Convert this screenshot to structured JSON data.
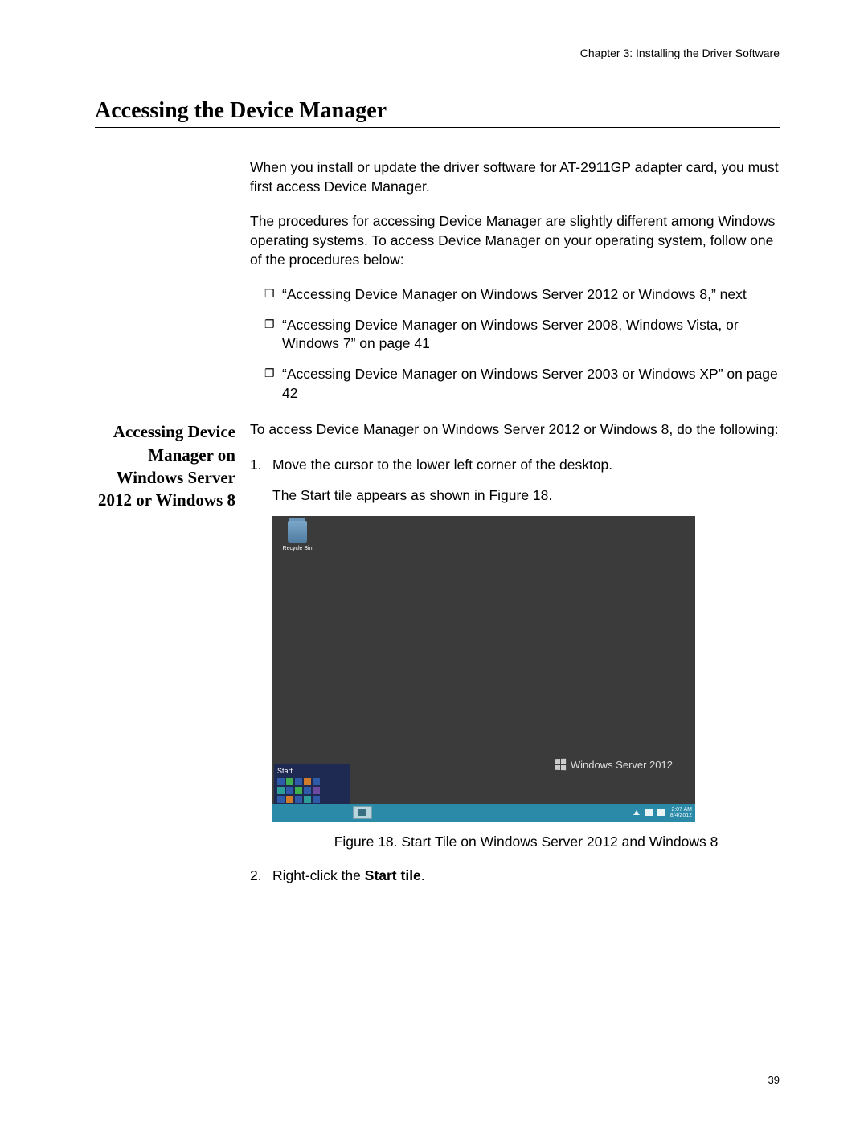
{
  "chapter_header": "Chapter 3: Installing the Driver Software",
  "main_heading": "Accessing the Device Manager",
  "intro_para1": "When you install or update the driver software for AT-2911GP adapter card, you must first access Device Manager.",
  "intro_para2": "The procedures for accessing Device Manager are slightly different among Windows operating systems. To access Device Manager on your operating system, follow one of the procedures below:",
  "list_items": [
    "“Accessing Device Manager on Windows Server 2012 or Windows 8,” next",
    "“Accessing Device Manager on Windows Server 2008, Windows Vista, or Windows 7” on page 41",
    "“Accessing Device Manager on Windows Server 2003 or Windows XP” on page 42"
  ],
  "sub_heading": "Accessing Device Manager on Windows Server 2012 or Windows 8",
  "sub_intro": "To access Device Manager on Windows Server 2012 or Windows 8, do the following:",
  "step1_marker": "1.",
  "step1_text": "Move the cursor to the lower left corner of the desktop.",
  "step1_result": "The Start tile appears as shown in Figure 18.",
  "screenshot": {
    "recycle_bin_label": "Recycle Bin",
    "brand_text": "Windows Server 2012",
    "start_label": "Start",
    "time": "2:07 AM",
    "date": "8/4/2012"
  },
  "figure_caption": "Figure 18. Start Tile on Windows Server 2012 and Windows 8",
  "step2_marker": "2.",
  "step2_prefix": "Right-click the ",
  "step2_bold": "Start tile",
  "step2_suffix": ".",
  "page_number": "39"
}
